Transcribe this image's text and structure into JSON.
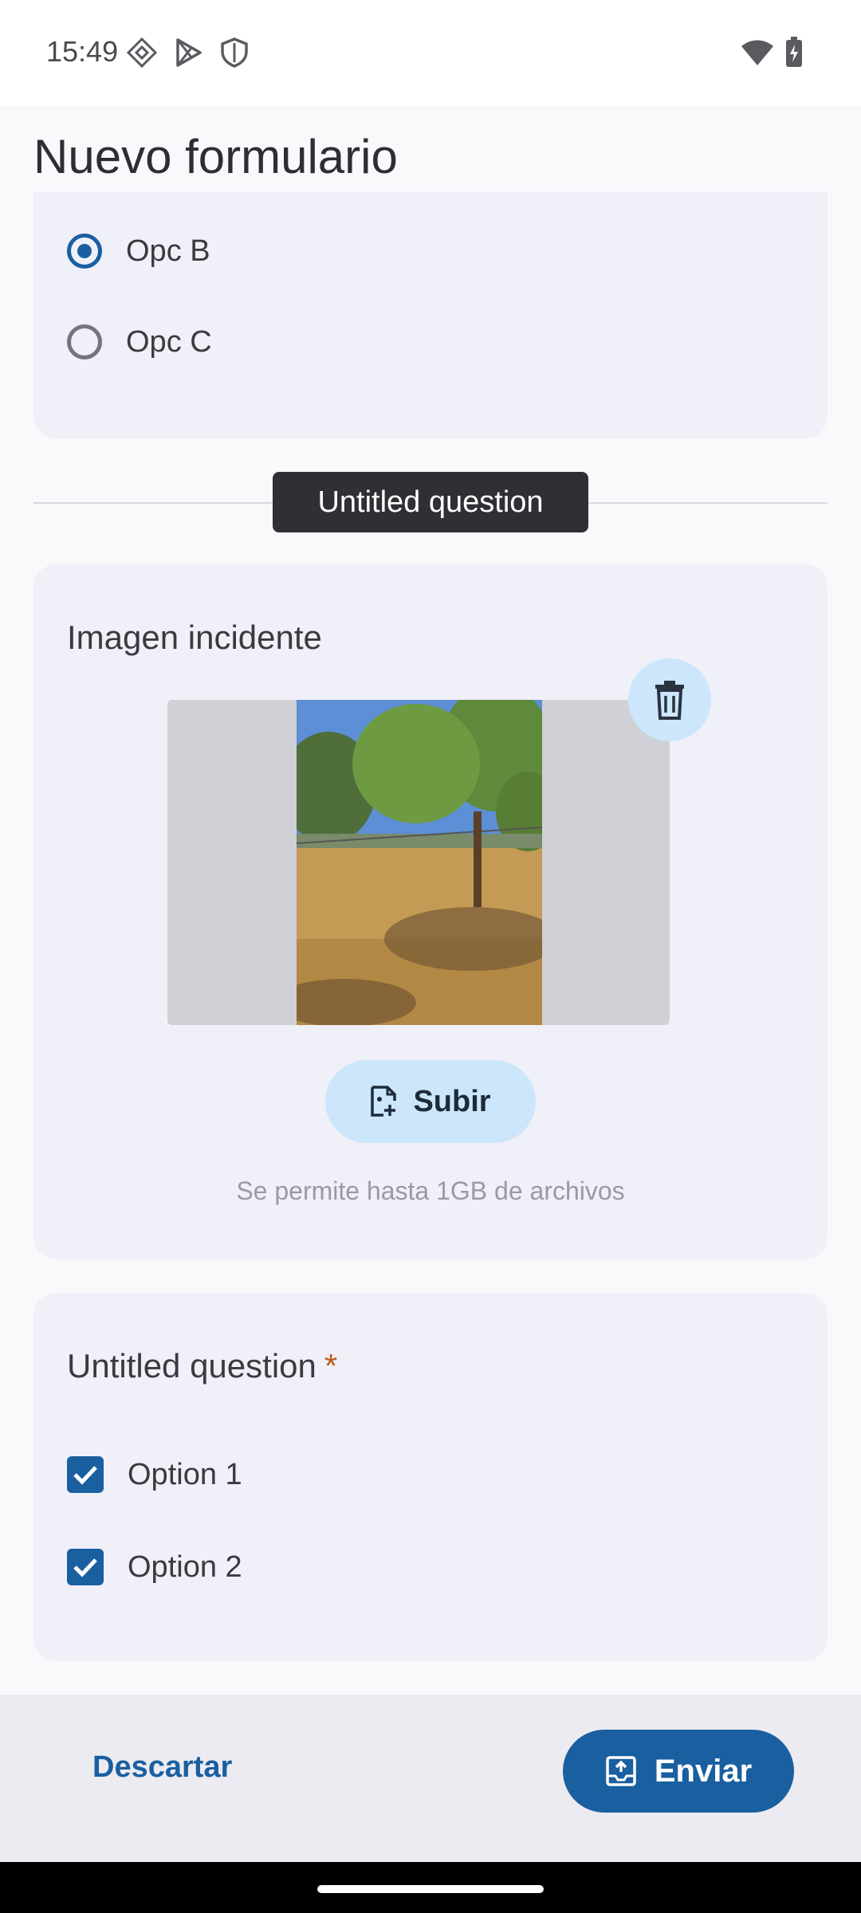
{
  "status_bar": {
    "time": "15:49",
    "icons": [
      "dev-settings-icon",
      "play-store-icon",
      "shield-icon",
      "wifi-icon",
      "battery-charging-icon"
    ]
  },
  "app_bar": {
    "title": "Nuevo formulario"
  },
  "radio_question": {
    "options": [
      {
        "label": "Opc B",
        "selected": true
      },
      {
        "label": "Opc C",
        "selected": false
      }
    ]
  },
  "tooltip": {
    "text": "Untitled question"
  },
  "image_question": {
    "title": "Imagen incidente",
    "upload_label": "Subir",
    "hint": "Se permite hasta 1GB de archivos",
    "photo_icon": "tree-photo"
  },
  "checkbox_question": {
    "title": "Untitled question",
    "required_mark": "*",
    "options": [
      {
        "label": "Option 1",
        "checked": true
      },
      {
        "label": "Option 2",
        "checked": true
      }
    ]
  },
  "bottom_bar": {
    "discard_label": "Descartar",
    "send_label": "Enviar"
  },
  "colors": {
    "accent": "#1a5fa0",
    "tonal": "#cce6fb",
    "required": "#c05a1c"
  }
}
